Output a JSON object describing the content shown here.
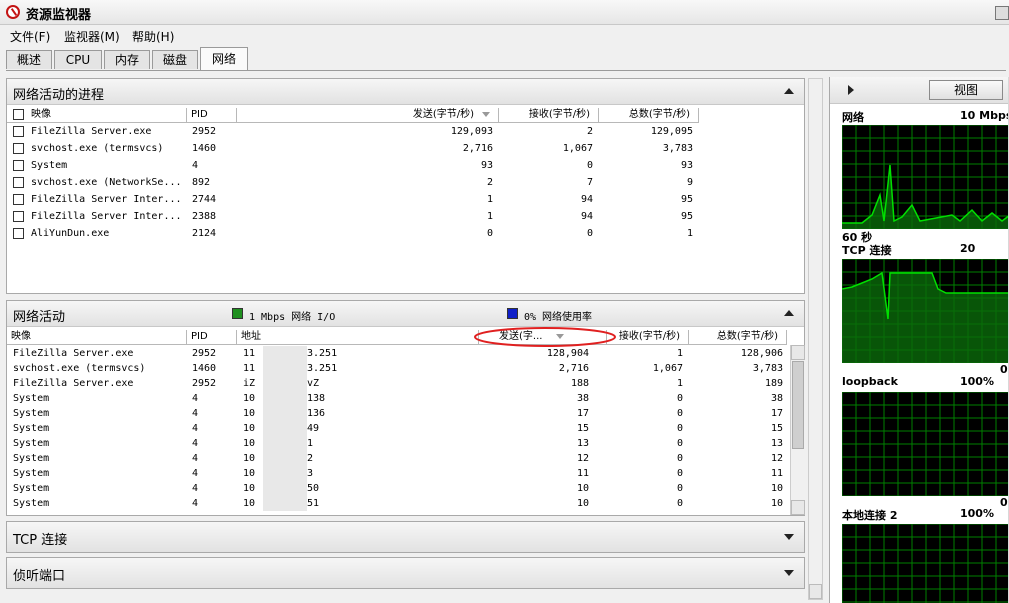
{
  "window": {
    "title": "资源监视器"
  },
  "menu": [
    "文件(F)",
    "监视器(M)",
    "帮助(H)"
  ],
  "tabs": [
    {
      "label": "概述",
      "active": false
    },
    {
      "label": "CPU",
      "active": false
    },
    {
      "label": "内存",
      "active": false
    },
    {
      "label": "磁盘",
      "active": false
    },
    {
      "label": "网络",
      "active": true
    }
  ],
  "processes_panel": {
    "title": "网络活动的进程",
    "headers": {
      "image": "映像",
      "pid": "PID",
      "send": "发送(字节/秒)",
      "recv": "接收(字节/秒)",
      "total": "总数(字节/秒)"
    },
    "rows": [
      {
        "image": "FileZilla Server.exe",
        "pid": "2952",
        "send": "129,093",
        "recv": "2",
        "total": "129,095"
      },
      {
        "image": "svchost.exe (termsvcs)",
        "pid": "1460",
        "send": "2,716",
        "recv": "1,067",
        "total": "3,783"
      },
      {
        "image": "System",
        "pid": "4",
        "send": "93",
        "recv": "0",
        "total": "93"
      },
      {
        "image": "svchost.exe (NetworkSe...",
        "pid": "892",
        "send": "2",
        "recv": "7",
        "total": "9"
      },
      {
        "image": "FileZilla Server Inter...",
        "pid": "2744",
        "send": "1",
        "recv": "94",
        "total": "95"
      },
      {
        "image": "FileZilla Server Inter...",
        "pid": "2388",
        "send": "1",
        "recv": "94",
        "total": "95"
      },
      {
        "image": "AliYunDun.exe",
        "pid": "2124",
        "send": "0",
        "recv": "0",
        "total": "1"
      }
    ]
  },
  "network_panel": {
    "title": "网络活动",
    "legend_io": "1 Mbps 网络 I/O",
    "legend_usage": "0% 网络使用率",
    "colors": {
      "io": "#1f8f1f",
      "usage": "#1020c8"
    },
    "headers": {
      "image": "映像",
      "pid": "PID",
      "address": "地址",
      "send": "发送(字...",
      "recv": "接收(字节/秒)",
      "total": "总数(字节/秒)"
    },
    "rows": [
      {
        "image": "FileZilla Server.exe",
        "pid": "2952",
        "addr_a": "11",
        "addr_b": "3.251",
        "send": "128,904",
        "recv": "1",
        "total": "128,906"
      },
      {
        "image": "svchost.exe (termsvcs)",
        "pid": "1460",
        "addr_a": "11",
        "addr_b": "3.251",
        "send": "2,716",
        "recv": "1,067",
        "total": "3,783"
      },
      {
        "image": "FileZilla Server.exe",
        "pid": "2952",
        "addr_a": "iZ",
        "addr_b": "vZ",
        "send": "188",
        "recv": "1",
        "total": "189"
      },
      {
        "image": "System",
        "pid": "4",
        "addr_a": "10",
        "addr_b": "138",
        "send": "38",
        "recv": "0",
        "total": "38"
      },
      {
        "image": "System",
        "pid": "4",
        "addr_a": "10",
        "addr_b": "136",
        "send": "17",
        "recv": "0",
        "total": "17"
      },
      {
        "image": "System",
        "pid": "4",
        "addr_a": "10",
        "addr_b": "49",
        "send": "15",
        "recv": "0",
        "total": "15"
      },
      {
        "image": "System",
        "pid": "4",
        "addr_a": "10",
        "addr_b": "1",
        "send": "13",
        "recv": "0",
        "total": "13"
      },
      {
        "image": "System",
        "pid": "4",
        "addr_a": "10",
        "addr_b": "2",
        "send": "12",
        "recv": "0",
        "total": "12"
      },
      {
        "image": "System",
        "pid": "4",
        "addr_a": "10",
        "addr_b": "3",
        "send": "11",
        "recv": "0",
        "total": "11"
      },
      {
        "image": "System",
        "pid": "4",
        "addr_a": "10",
        "addr_b": "50",
        "send": "10",
        "recv": "0",
        "total": "10"
      },
      {
        "image": "System",
        "pid": "4",
        "addr_a": "10",
        "addr_b": "51",
        "send": "10",
        "recv": "0",
        "total": "10"
      }
    ]
  },
  "tcp_panel": {
    "title": "TCP 连接"
  },
  "listen_panel": {
    "title": "侦听端口"
  },
  "right_pane": {
    "view_button": "视图",
    "graphs": [
      {
        "label": "网络",
        "right": "10 Mbps",
        "bottom_left": "60 秒",
        "bottom_right": ""
      },
      {
        "label": "TCP 连接",
        "right": "20",
        "bottom_left": "",
        "bottom_right": "0"
      },
      {
        "label": "loopback",
        "right": "100%",
        "bottom_left": "",
        "bottom_right": "0"
      },
      {
        "label": "本地连接 2",
        "right": "100%",
        "bottom_left": "",
        "bottom_right": ""
      }
    ],
    "grid_color": "#008000",
    "line_color": "#00e000"
  }
}
